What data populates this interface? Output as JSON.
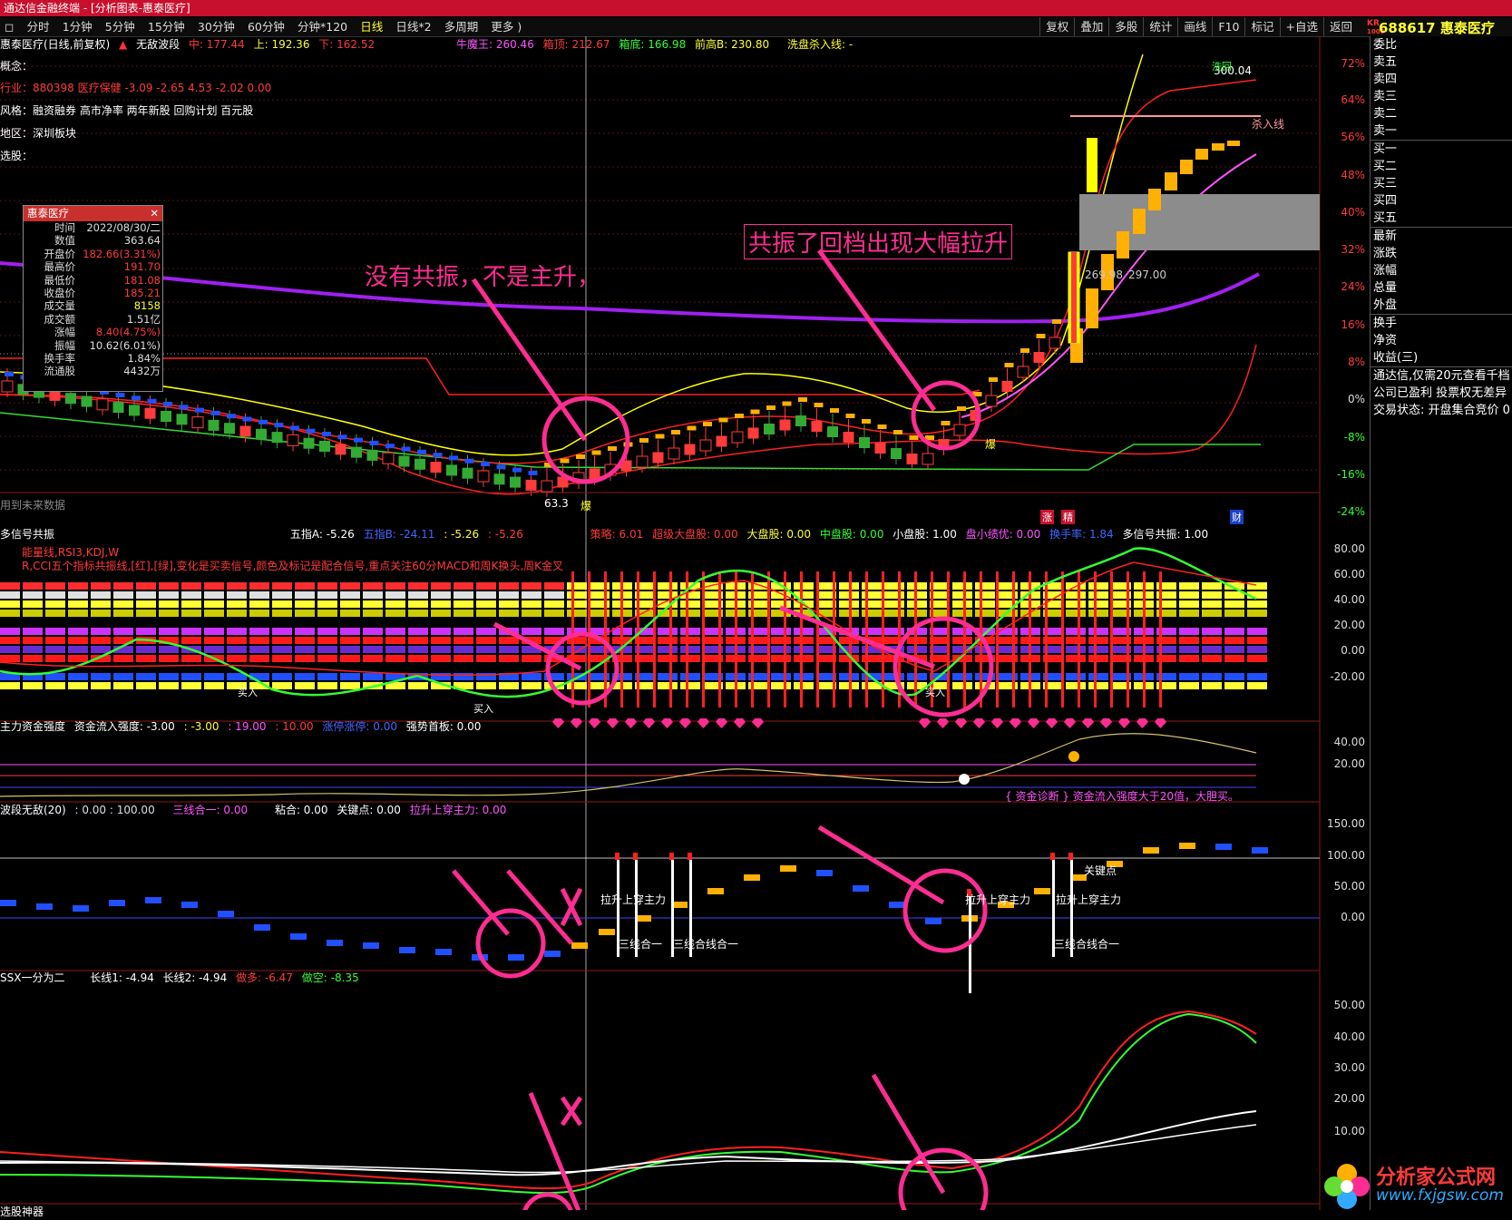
{
  "titlebar": {
    "app": "通达信金融终端",
    "doc": "[分析图表-惠泰医疗]"
  },
  "toolbar": {
    "periods": [
      "分时",
      "1分钟",
      "5分钟",
      "15分钟",
      "30分钟",
      "60分钟",
      "分钟*120",
      "日线",
      "日线*2",
      "多周期",
      "更多 )"
    ],
    "active": "日线",
    "right": [
      "复权",
      "叠加",
      "多股",
      "统计",
      "画线",
      "F10",
      "标记",
      "+自选",
      "返回"
    ]
  },
  "stock": {
    "code": "688617",
    "name": "惠泰医疗",
    "badge_top": "KR",
    "badge_bottom": "1000"
  },
  "main": {
    "header": {
      "name": "惠泰医疗(日线,前复权)",
      "ind": "无敌波段",
      "mid": "中: 177.44",
      "up": "上: 192.36",
      "down": "下: 162.52",
      "niu": "牛魔王: 260.46",
      "xiang": "箱顶: 212.67",
      "xiangdi": "箱底: 166.98",
      "qian": "前高B: 230.80",
      "xipan": "洗盘杀入线: -"
    },
    "concept": "概念：",
    "industry": "行业：880398 医疗保健 -3.09 -2.65 4.53 -2.02 0.00",
    "style": "风格：融资融券 高市净率 两年新股 回购计划 百元股",
    "region": "地区：深圳板块",
    "select": "选股：",
    "future": "用到未来数据",
    "axis": [
      "72%",
      "64%",
      "56%",
      "48%",
      "40%",
      "32%",
      "24%",
      "16%",
      "8%",
      "0%",
      "-8%",
      "-16%",
      "-24%"
    ],
    "labels": {
      "box_low": "269.98",
      "box_high": "297.00",
      "top": "300.04",
      "killin": "杀入线",
      "low": "63.3",
      "bao": "爆",
      "bao2": "爆",
      "zhang": "涨",
      "jing": "精",
      "cai": "财",
      "note": "洗回"
    }
  },
  "infobox": {
    "title": "惠泰医疗",
    "rows": [
      {
        "k": "时间",
        "v": "2022/08/30/二",
        "c": "#ddd"
      },
      {
        "k": "数值",
        "v": "363.64",
        "c": "#ddd"
      },
      {
        "k": "开盘价",
        "v": "182.66(3.31%)",
        "c": "#ff3b3b"
      },
      {
        "k": "最高价",
        "v": "191.70",
        "c": "#ff3b3b"
      },
      {
        "k": "最低价",
        "v": "181.08",
        "c": "#ff3b3b"
      },
      {
        "k": "收盘价",
        "v": "185.21",
        "c": "#ff3b3b"
      },
      {
        "k": "成交量",
        "v": "8158",
        "c": "#ffff33"
      },
      {
        "k": "成交额",
        "v": "1.51亿",
        "c": "#ddd"
      },
      {
        "k": "涨幅",
        "v": "8.40(4.75%)",
        "c": "#ff3b3b"
      },
      {
        "k": "振幅",
        "v": "10.62(6.01%)",
        "c": "#ddd"
      },
      {
        "k": "换手率",
        "v": "1.84%",
        "c": "#ddd"
      },
      {
        "k": "流通股",
        "v": "4432万",
        "c": "#ddd"
      }
    ]
  },
  "annotations": {
    "a1": "没有共振，不是主升，",
    "a2": "共振了回档出现大幅拉升"
  },
  "p2": {
    "name": "多信号共振",
    "vals": [
      "五指A: -5.26",
      "五指B: -24.11",
      ": -5.26",
      ": -5.26",
      "策略: 6.01",
      "超级大盘股: 0.00",
      "大盘股: 0.00",
      "中盘股: 0.00",
      "小盘股: 1.00",
      "盘小绩优: 0.00",
      "换手率: 1.84",
      "多信号共振: 1.00"
    ],
    "note1": "能量线,RSI3,KDJ,W",
    "note2": "R,CCI五个指标共振线,[红],[绿],变化是买卖信号,颜色及标记是配合信号,重点关注60分MACD和周K换头,周K金叉",
    "axis": [
      "80.00",
      "60.00",
      "40.00",
      "20.00",
      "0.00",
      "-20.00"
    ],
    "buy": "买入"
  },
  "p3": {
    "name": "主力资金强度",
    "vals": [
      "资金流入强度: -3.00",
      ": -3.00",
      ": 19.00",
      ": 10.00",
      "涨停涨停: 0.00",
      "强势首板: 0.00"
    ],
    "axis": [
      "40.00",
      "20.00"
    ],
    "diag": "{ 资金诊断 } 资金流入强度大于20值，大胆买。"
  },
  "p4": {
    "name": "波段无敌(20)",
    "vals": [
      ": 0.00 : 100.00",
      "三线合一: 0.00",
      "粘合: 0.00",
      "关键点: 0.00",
      "拉升上穿主力: 0.00"
    ],
    "axis": [
      "150.00",
      "100.00",
      "50.00",
      "0.00"
    ],
    "labels": [
      "拉升上穿主力",
      "三线合一",
      "三线合线合一",
      "拉升上穿主力",
      "拉升上穿主力",
      "三线合线合一",
      "关键点"
    ]
  },
  "p5": {
    "name": "SSX一分为二",
    "vals": [
      "长线1: -4.94",
      "长线2: -4.94",
      "做多: -6.47",
      "做空: -8.35"
    ],
    "axis": [
      "50.00",
      "40.00",
      "30.00",
      "20.00",
      "10.00"
    ],
    "bottom": "选股神器"
  },
  "right": {
    "book": [
      "委比",
      "卖五",
      "卖四",
      "卖三",
      "卖二",
      "卖一",
      "买一",
      "买二",
      "买三",
      "买四",
      "买五"
    ],
    "stats": [
      "最新",
      "涨跌",
      "涨幅",
      "总量",
      "外盘"
    ],
    "stats2": [
      "换手",
      "净资",
      "收益(三)"
    ],
    "msgs": [
      "通达信,仅需20元查看千档",
      "公司已盈利 投票权无差异",
      "交易状态: 开盘集合竞价 0"
    ]
  },
  "watermark": {
    "text": "分析家公式网",
    "url": "www.fxjgsw.com"
  },
  "colors": {
    "up": "#ff3b3b",
    "down": "#00c8ff",
    "accent": "#ff2d92",
    "gold": "#ffb000",
    "purple": "#a020f0"
  }
}
